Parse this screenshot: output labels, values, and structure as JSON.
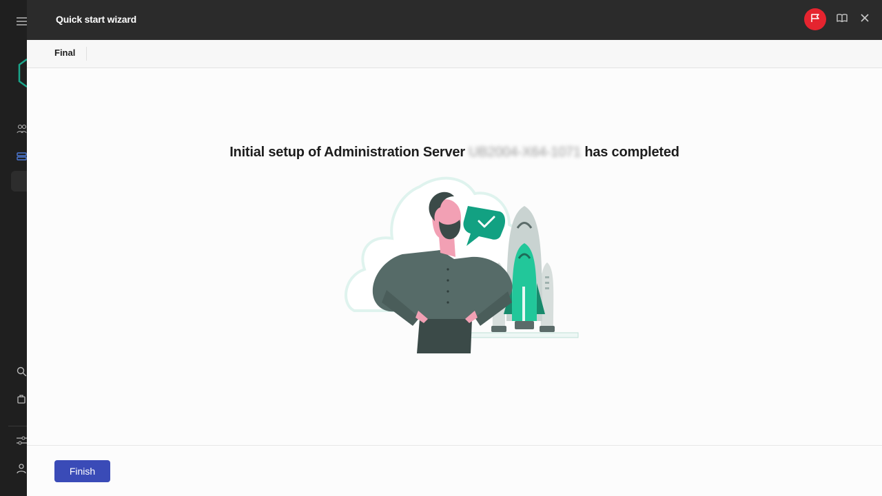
{
  "wizard": {
    "title": "Quick start wizard",
    "step_label": "Final",
    "heading_prefix": "Initial setup of Administration Server",
    "server_name": "UB2004-X64-1071",
    "heading_suffix": "has completed",
    "finish_label": "Finish"
  },
  "header_icons": [
    "flag-icon",
    "book-icon",
    "close-icon"
  ],
  "sidebar_icons": [
    "menu-icon",
    "logo-icon",
    "users-icon",
    "servers-icon",
    "search-icon",
    "bag-icon",
    "settings-icon",
    "user-icon"
  ],
  "colors": {
    "header_bg": "#2b2b2b",
    "flag_accent": "#e5242f",
    "primary_button": "#3a4bb7",
    "illustration_accent": "#1fbf8f"
  }
}
